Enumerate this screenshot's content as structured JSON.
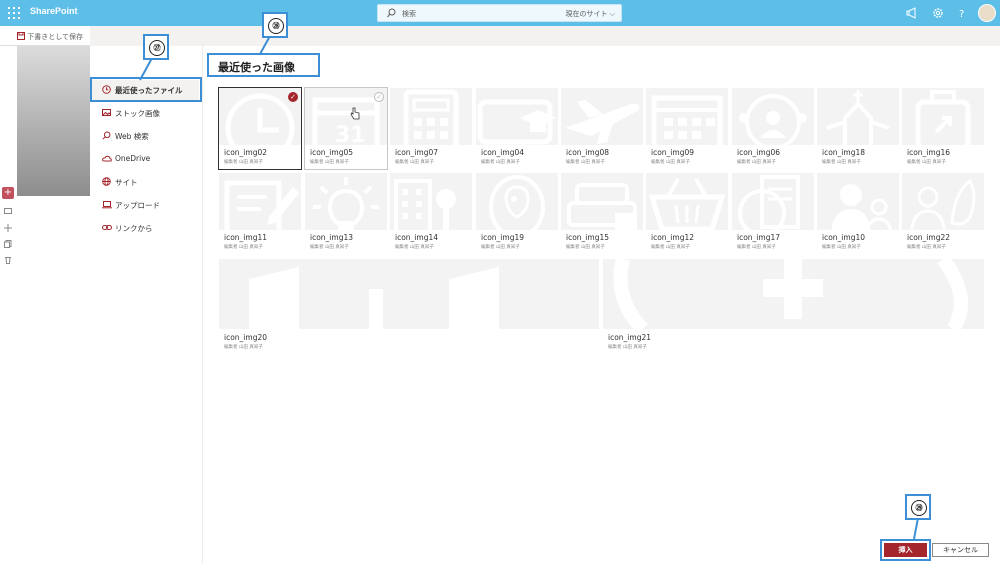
{
  "header": {
    "brand": "SharePoint",
    "search_placeholder": "検索",
    "search_scope": "現在のサイト"
  },
  "page": {
    "save_draft": "下書きとして保存"
  },
  "nav": {
    "items": [
      {
        "label": "最近使ったファイル",
        "icon": "clock-icon",
        "active": true
      },
      {
        "label": "ストック画像",
        "icon": "image-icon"
      },
      {
        "label": "Web 検索",
        "icon": "search-icon"
      },
      {
        "label": "OneDrive",
        "icon": "cloud-icon"
      },
      {
        "label": "サイト",
        "icon": "globe-icon"
      },
      {
        "label": "アップロード",
        "icon": "laptop-icon"
      },
      {
        "label": "リンクから",
        "icon": "link-icon"
      }
    ]
  },
  "section_title": "最近使った画像",
  "annotations": {
    "a27": "㉗",
    "a28": "㉘",
    "a29": "㉙"
  },
  "images": [
    {
      "name": "icon_img02",
      "author": "編集者 山田 真知子"
    },
    {
      "name": "icon_img05",
      "author": "編集者 山田 真知子"
    },
    {
      "name": "icon_img07",
      "author": "編集者 山田 真知子"
    },
    {
      "name": "icon_img04",
      "author": "編集者 山田 真知子"
    },
    {
      "name": "icon_img08",
      "author": "編集者 山田 真知子"
    },
    {
      "name": "icon_img09",
      "author": "編集者 山田 真知子"
    },
    {
      "name": "icon_img06",
      "author": "編集者 山田 真知子"
    },
    {
      "name": "icon_img18",
      "author": "編集者 山田 真知子"
    },
    {
      "name": "icon_img16",
      "author": "編集者 山田 真知子"
    },
    {
      "name": "icon_img11",
      "author": "編集者 山田 真知子"
    },
    {
      "name": "icon_img13",
      "author": "編集者 山田 真知子"
    },
    {
      "name": "icon_img14",
      "author": "編集者 山田 真知子"
    },
    {
      "name": "icon_img19",
      "author": "編集者 山田 真知子"
    },
    {
      "name": "icon_img15",
      "author": "編集者 山田 真知子"
    },
    {
      "name": "icon_img12",
      "author": "編集者 山田 真知子"
    },
    {
      "name": "icon_img17",
      "author": "編集者 山田 真知子"
    },
    {
      "name": "icon_img10",
      "author": "編集者 山田 真知子"
    },
    {
      "name": "icon_img22",
      "author": "編集者 山田 真知子"
    },
    {
      "name": "icon_img20",
      "author": "編集者 山田 真知子"
    },
    {
      "name": "icon_img21",
      "author": "編集者 山田 真知子"
    }
  ],
  "actions": {
    "insert": "挿入",
    "cancel": "キャンセル"
  },
  "colors": {
    "suite_bar": "#5dbfe8",
    "accent": "#a4262c",
    "highlight": "#3c8fd4"
  }
}
